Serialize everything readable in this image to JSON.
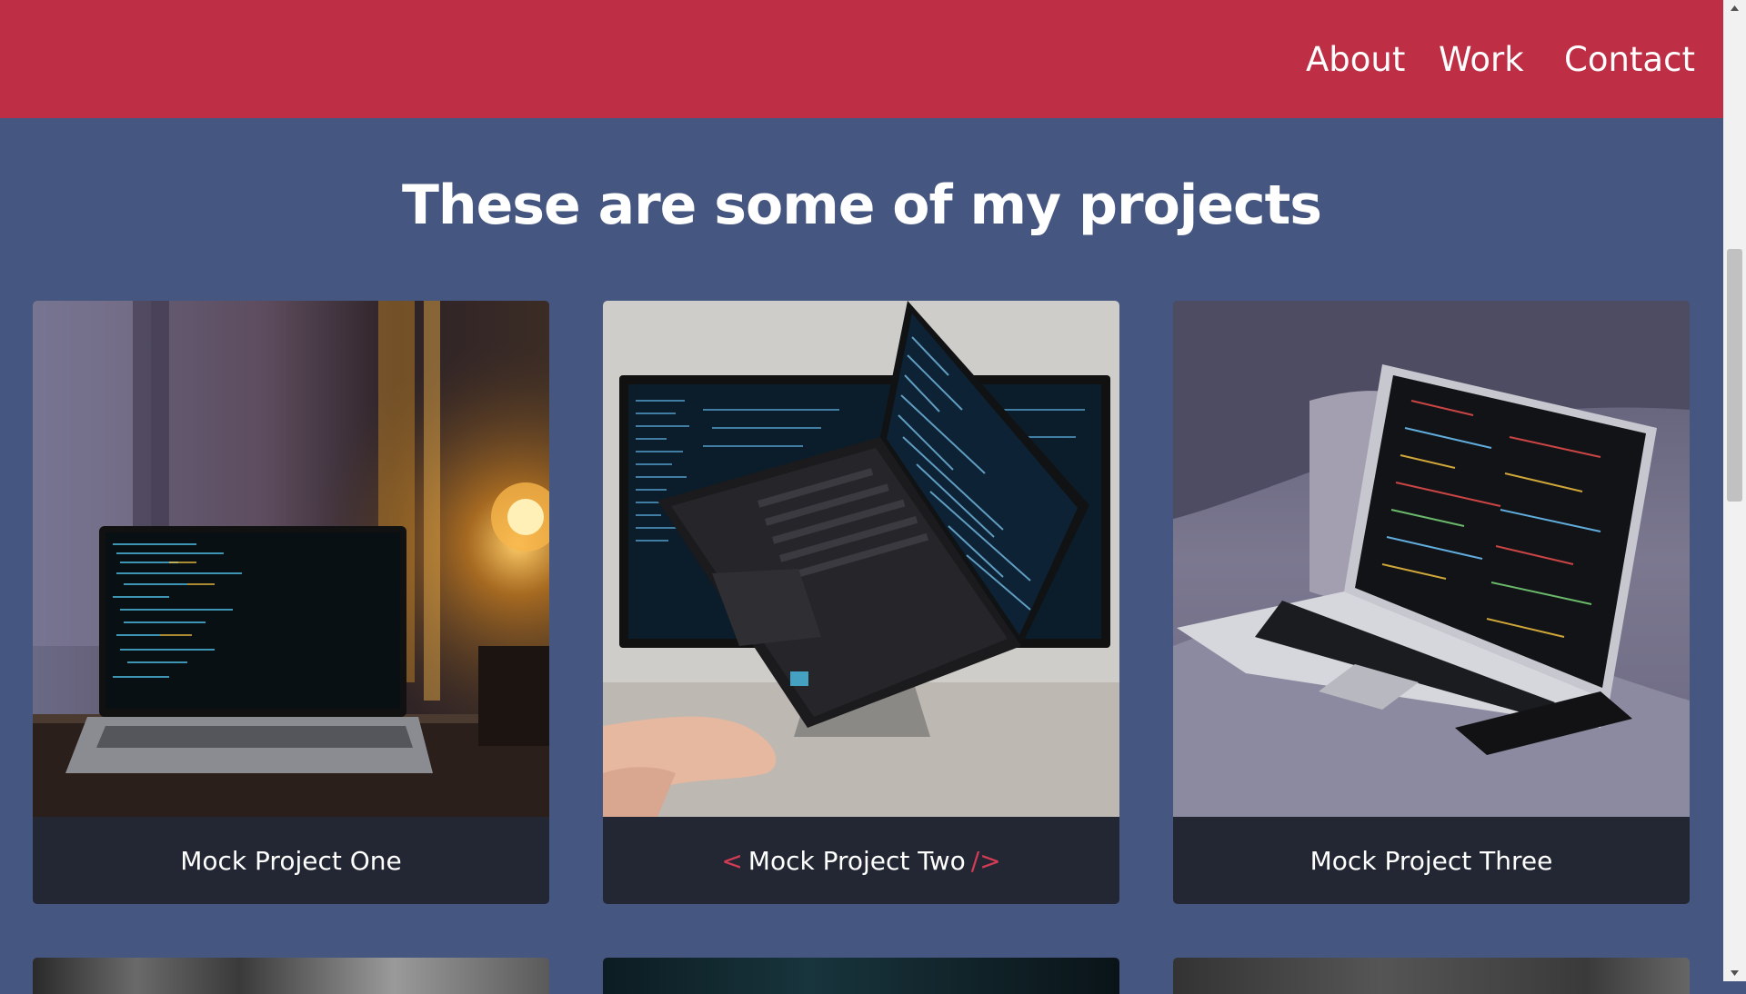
{
  "nav": {
    "items": [
      "About",
      "Work",
      "Contact"
    ]
  },
  "projects": {
    "heading": "These are some of my projects",
    "cards": [
      {
        "title": "Mock Project One",
        "image": "laptop-by-window-lamp-photo"
      },
      {
        "title": "Mock Project Two",
        "prefix": "<",
        "suffix": "/>",
        "image": "hand-holding-laptop-photo"
      },
      {
        "title": "Mock Project Three",
        "image": "laptop-on-sofa-photo"
      }
    ]
  },
  "colors": {
    "header": "#be2e44",
    "background": "#455681",
    "card_footer": "#232733",
    "accent": "#d43c55"
  }
}
